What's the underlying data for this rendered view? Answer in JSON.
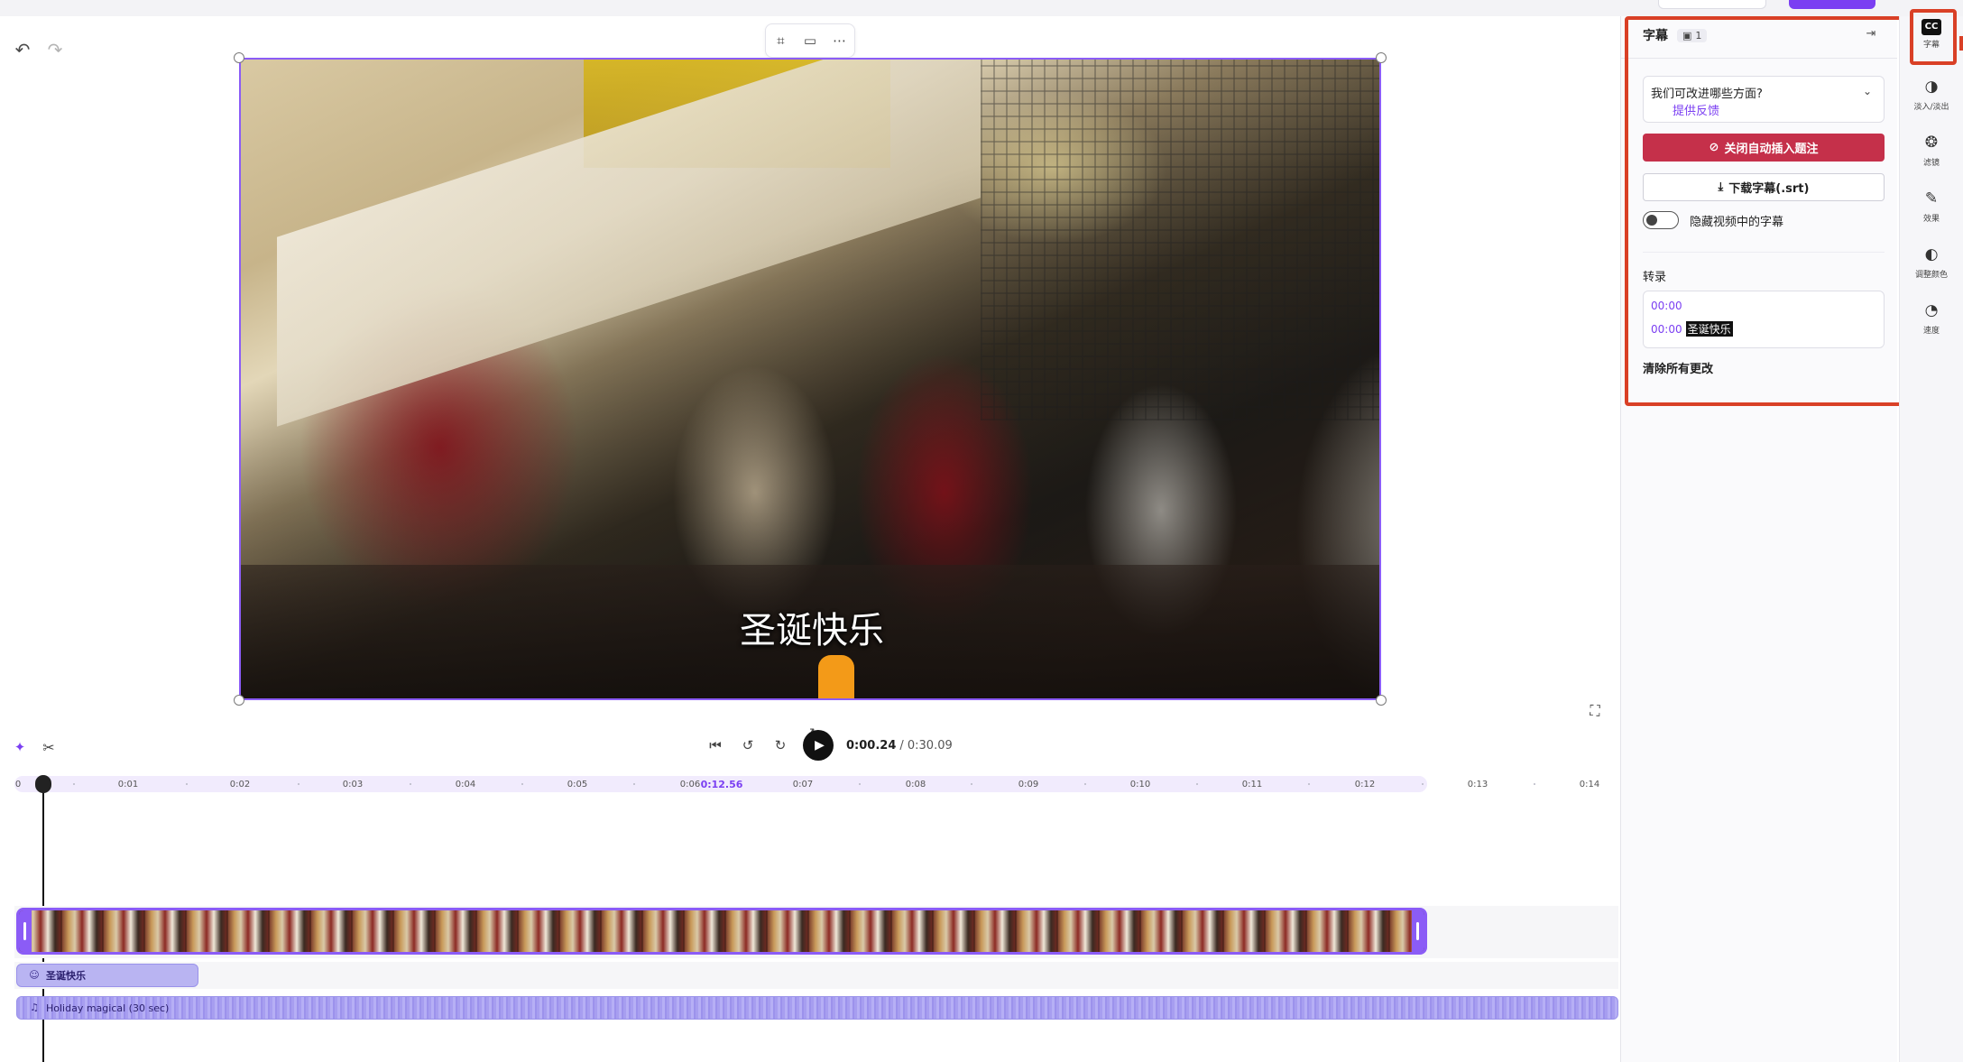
{
  "colors": {
    "accent": "#7b3ff2",
    "danger": "#c5304a",
    "highlight": "#d94026"
  },
  "editor": {
    "undo_icon": "undo-icon",
    "redo_icon": "redo-icon",
    "canvas_toolbar": [
      "crop-icon",
      "fit-icon",
      "more-icon"
    ],
    "video_caption": "圣诞快乐"
  },
  "playback": {
    "current_time": "0:00.24",
    "total_time": "/ 0:30.09"
  },
  "ruler": {
    "ticks": [
      "0",
      "0:01",
      "0:02",
      "0:03",
      "0:04",
      "0:05",
      "0:06",
      "0:07",
      "0:08",
      "0:09",
      "0:10",
      "0:11",
      "0:12",
      "0:13",
      "0:14"
    ],
    "current_marker": "0:12.56"
  },
  "tracks": {
    "caption_clip": "圣诞快乐",
    "audio_clip": "Holiday magical (30 sec)"
  },
  "panel": {
    "title": "字幕",
    "badge_count": "1",
    "feedback_question": "我们可改进哪些方面?",
    "feedback_link": "提供反馈",
    "disable_button": "关闭自动插入题注",
    "download_button": "下载字幕(.srt)",
    "toggle_label": "隐藏视频中的字幕",
    "transcript_title": "转录",
    "transcript": [
      {
        "time": "00:00",
        "text": ""
      },
      {
        "time": "00:00",
        "text": "圣诞快乐"
      }
    ],
    "clear_changes": "清除所有更改"
  },
  "rail": [
    {
      "icon": "captions-icon",
      "label": "字幕"
    },
    {
      "icon": "fade-icon",
      "label": "淡入/淡出"
    },
    {
      "icon": "filters-icon",
      "label": "滤镜"
    },
    {
      "icon": "effects-icon",
      "label": "效果"
    },
    {
      "icon": "adjust-colors-icon",
      "label": "调整颜色"
    },
    {
      "icon": "speed-icon",
      "label": "速度"
    }
  ]
}
